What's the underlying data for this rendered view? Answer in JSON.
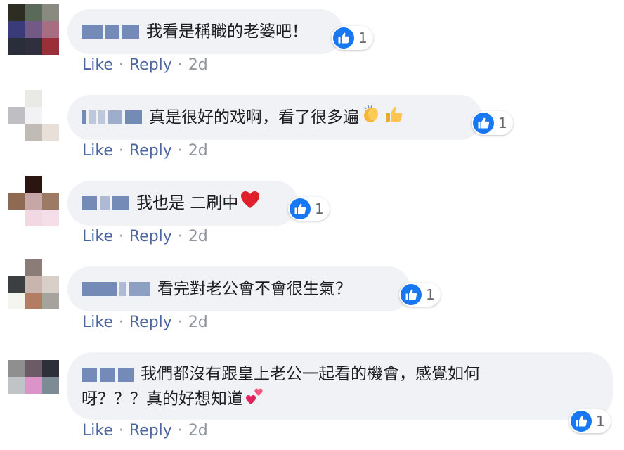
{
  "comments": [
    {
      "text": "我看是稱職的老婆吧！",
      "like_count": "1",
      "time": "2d",
      "avatar": [
        "#2d2d22",
        "#5a6a5a",
        "#8a8a80",
        "#3a3c7a",
        "#735a86",
        "#a76d80",
        "#2a2e3a",
        "#2f2f3f",
        "#9a2f3a"
      ]
    },
    {
      "text": "真是很好的戏啊，看了很多遍",
      "emoji": [
        "clapping-hands-icon",
        "thumbs-up-icon"
      ],
      "like_count": "1",
      "time": "2d",
      "avatar": [
        "#ffffff",
        "#e9e9e6",
        "#ffffff",
        "#bfbfc3",
        "#f2f2f5",
        "#ffffff",
        "#ffffff",
        "#c0bbb4",
        "#e8e0d8"
      ]
    },
    {
      "text": "我也是 二刷中",
      "emoji": [
        "red-heart-icon"
      ],
      "like_count": "1",
      "time": "2d",
      "avatar": [
        "#ffffff",
        "#2a1510",
        "#ffffff",
        "#8e6a52",
        "#c7a7a5",
        "#9c7a64",
        "#ffffff",
        "#f2d8e2",
        "#f6dee8"
      ]
    },
    {
      "text": "看完對老公會不會很生氣？",
      "like_count": "1",
      "time": "2d",
      "avatar": [
        "#ffffff",
        "#8b7c78",
        "#ffffff",
        "#3b3f42",
        "#c9b4ae",
        "#d9cfc9",
        "#f4f4ef",
        "#b47c62",
        "#a6a29d"
      ]
    },
    {
      "text": "我們都沒有跟皇上老公一起看的機會，感覺如何呀？？？真的好想知道",
      "emoji": [
        "two-hearts-icon"
      ],
      "like_count": "1",
      "time": "2d",
      "avatar": [
        "#8f8f90",
        "#6c5a66",
        "#2d3038",
        "#c0c4c7",
        "#dc93c8",
        "#7d8c94",
        "#ffffff",
        "#ffffff",
        "#ffffff"
      ]
    }
  ],
  "actions": {
    "like": "Like",
    "reply": "Reply",
    "separator": "·"
  },
  "colors": {
    "link": "#4b67a1",
    "like_blue": "#1877f2",
    "bubble": "#f0f2f5"
  }
}
